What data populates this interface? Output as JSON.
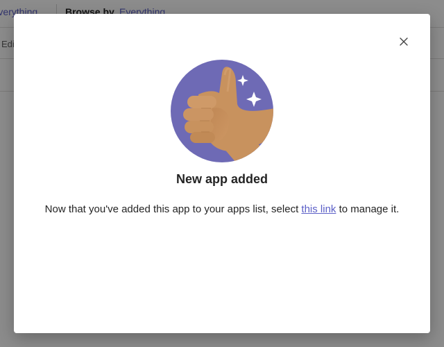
{
  "background": {
    "top_link": "Everything",
    "browse_label": "Browse by",
    "browse_value": "Everything",
    "edit_label": "Edit"
  },
  "dialog": {
    "close_icon": "close-icon",
    "illustration": "thumbs-up-illustration",
    "title": "New app added",
    "message_before": "Now that you've added this app to your apps list, select ",
    "link_text": "this link",
    "message_after": " to manage it."
  },
  "colors": {
    "accent": "#5b5fc7",
    "illustration_circle": "#6e6ab5",
    "hand": "#c8925e"
  }
}
